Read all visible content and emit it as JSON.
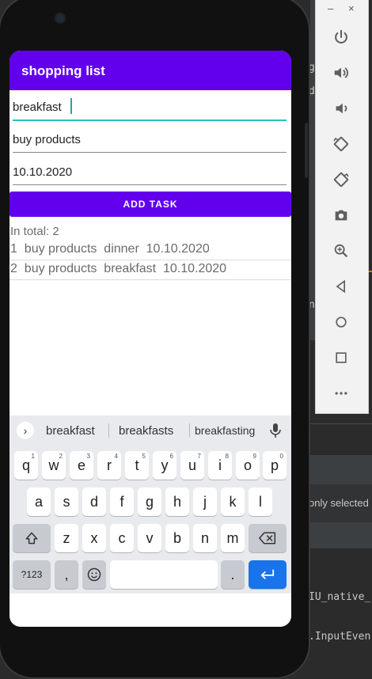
{
  "emulator": {
    "minimize_label": "–",
    "close_label": "×",
    "buttons": [
      "power-icon",
      "volume-up-icon",
      "volume-down-icon",
      "rotate-left-icon",
      "rotate-right-icon",
      "camera-icon",
      "zoom-icon",
      "back-icon",
      "home-icon",
      "overview-icon",
      "more-icon"
    ]
  },
  "ide": {
    "snip_g": "g",
    "snip_di": "di",
    "snip_n": "n",
    "snip_only_selected": "only selected",
    "snip_native": "IU_native_",
    "snip_inputevent": ".InputEven"
  },
  "app": {
    "title": "shopping list",
    "field1_value": "breakfast",
    "field2_value": "buy products",
    "field3_value": "10.10.2020",
    "add_button_label": "ADD TASK",
    "total_text": "In total: 2",
    "tasks": [
      {
        "text": "1  buy products  dinner  10.10.2020"
      },
      {
        "text": "2  buy products  breakfast  10.10.2020"
      }
    ]
  },
  "keyboard": {
    "suggestions": [
      "breakfast",
      "breakfasts",
      "breakfasting"
    ],
    "row1": [
      {
        "k": "q",
        "n": "1"
      },
      {
        "k": "w",
        "n": "2"
      },
      {
        "k": "e",
        "n": "3"
      },
      {
        "k": "r",
        "n": "4"
      },
      {
        "k": "t",
        "n": "5"
      },
      {
        "k": "y",
        "n": "6"
      },
      {
        "k": "u",
        "n": "7"
      },
      {
        "k": "i",
        "n": "8"
      },
      {
        "k": "o",
        "n": "9"
      },
      {
        "k": "p",
        "n": "0"
      }
    ],
    "row2": [
      "a",
      "s",
      "d",
      "f",
      "g",
      "h",
      "j",
      "k",
      "l"
    ],
    "row3": [
      "z",
      "x",
      "c",
      "v",
      "b",
      "n",
      "m"
    ],
    "symbols_label": "?123",
    "comma_label": ",",
    "period_label": "."
  },
  "colors": {
    "primary": "#6200ee",
    "accent_underline": "#26c6b8",
    "enter_key": "#1a73e8"
  }
}
